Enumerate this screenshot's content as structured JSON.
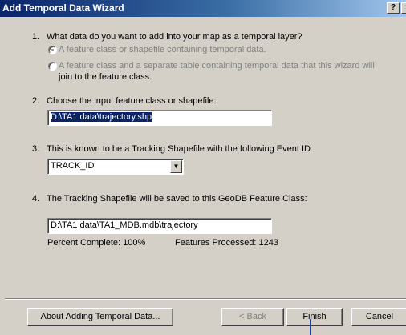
{
  "window": {
    "title": "Add Temporal Data Wizard"
  },
  "title_buttons": {
    "help": "?",
    "close": "×"
  },
  "q1": {
    "number": "1.",
    "text": "What data do you want to add into your map as a temporal layer?",
    "option_a": "A feature class or shapefile containing temporal data.",
    "option_b_line1": "A feature class and a separate table containing temporal data that this wizard will",
    "option_b_line2": "join to the feature class."
  },
  "q2": {
    "number": "2.",
    "text": "Choose the input feature class or shapefile:",
    "value": "D:\\TA1 data\\trajectory.shp"
  },
  "q3": {
    "number": "3.",
    "text": "This is known to be a Tracking Shapefile with the following Event ID",
    "value": "TRACK_ID"
  },
  "q4": {
    "number": "4.",
    "text": "The Tracking Shapefile will be saved to this GeoDB Feature Class:",
    "value": "D:\\TA1 data\\TA1_MDB.mdb\\trajectory"
  },
  "progress": {
    "percent_text": "Percent Complete: 100%",
    "features_text": "Features Processed: 1243"
  },
  "buttons": {
    "about": "About Adding Temporal Data...",
    "back": "< Back",
    "finish": "Finish",
    "cancel": "Cancel"
  }
}
